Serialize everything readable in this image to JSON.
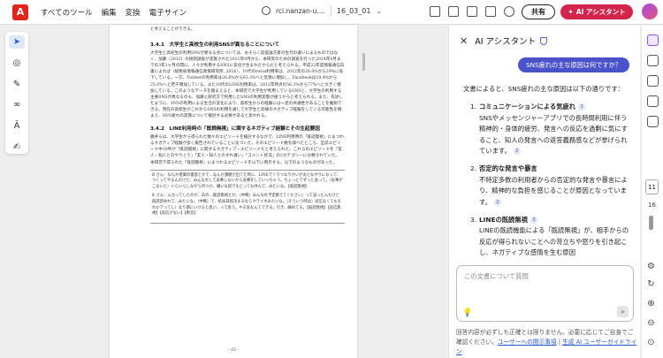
{
  "topbar": {
    "menu": [
      "すべてのツール",
      "編集",
      "変換",
      "電子サイン"
    ],
    "url": "rci.nanzan-u....",
    "filename": "16_03_01",
    "share_label": "共有",
    "ai_label": "AI アシスタント"
  },
  "document": {
    "top_line": "と考えることができる。",
    "section1_title": "3.4.1　大学生と高校生の利用SNSが異なることについて",
    "section1_body": "大学生と高校生の利用SNSが異なる点については、おそらく前提論方者の生代の違いによるものではなく、加藤（2013）の接続調査が実施された2011年9月から、本研究のための調査を行った2014年9月までの3年1ヶ月の間に、人々が利用するSNSに変化が生まれたからだと考えられる。平成22年度情報通信白書によれば（総務省情報通信政策研究所, 2016）、10代のtwiss利用率は、2012年の26.0%から29%に低下している。一方、Twitterの利用率は26.6%から63.3%へと急激に増加し、Facebookは19.4%から25.0%へと若干増加している。また10代のLINE利用率は、2012年時点の56.3%から77%へと大きく増加している。このようなデータを踏まえると、本研究で大学生が利用しているSNSと、大学生の利用する主要SNSが異なるのも、加藤と研究方で利用したSNSの利用実態が違うからと考えられる。また、先述したように、SNSの利用による生活の変化により、高校生からの経験には一定の共通性があることを推測できる。現在の高校生がこれからSNSの利用を通して大学生と同様のネガティブ経験をしている可能性を踏まえ、SNS疲れの実態について検討する必要があると思われる。",
    "section2_title": "3.4.2　LINE利用時の「既読無視」に関するネガティブ経験とその生起要因",
    "section2_body": "藤井らは、大学生から得られた数々のエピソードを検討するなかで、LINE利用時の「既読無視」にまつわるネガティブ経験が多く報告されていることに気づいた。そのエピソード数を調べたところ、全誌エピソード中30件が「既読無視」に関するネガティブ・エピソードだと考えられた。これらのエピソードを「友人・知人とのやりとり」「友人・知人とのすれ違い」「コメント状況」の3カテゴリーに分類されていた。",
    "section2_body2": "本研究で得られた「既読無視」にまつわるエピソードを以下に例示する。以下のようなものがあった。",
    "box1": "B さん：なんか授業の復習とかで…なんか課題が出てた時に、LINEでくりつなりかいがおとなやりになって、つくってやるんだけど、みんな大して返事しないから返事をしていっちゃう。ちょっとでずっと送って。（返事がこないと）いらいらしながら待つか、嫌いな奴でもどっても呼んで、みたいな。【既読無視】",
    "box2": "K さん：ムカってしたのが、あの…既読無視とか、（中略）みんなの予定教えてください」って送ったんだけど既読読めれて、みたいな。（中略）で、結局日程決まるならクライネみたいな。（そういう時は）返信なくてもそれかアってし）なり期にいけると思い、って思う。やる気なんてできる。引き、練めてる。【既読無視】【返信無視】【返信がない】【断念】",
    "page_number": "– 43 –"
  },
  "panel": {
    "title": "AI アシスタント",
    "user_question": "SNS疲れの主な原因は何ですか？",
    "intro": "文書によると、SNS疲れの主な原因は以下の通りです：",
    "items": [
      {
        "num": "1.",
        "head": "コミュニケーションによる気疲れ",
        "cite": "1",
        "body": "SNSやメッセンジャーアプリでの長時間利用に伴う精神的・身体的疲労、発言への反応を過剰に気にすること、知人の発言への返答義務感などが挙げられています。",
        "cite2": "2"
      },
      {
        "num": "2.",
        "head": "否定的な発言や暴言",
        "cite": "",
        "body": "不特定多数の利用者からの否定的な発言や暴言により、精神的な負担を感じることが原因となっています。",
        "cite2": "2"
      },
      {
        "num": "3.",
        "head": "LINEの既読無視",
        "cite": "3",
        "body": "LINEの既読機能による「既読無視」が、相手からの反応が得られないことへの苛立ちや怒りを引き起こし、ネガティブな感情を生む原因",
        "cite2": ""
      }
    ],
    "input_placeholder": "この文書について質問",
    "disclaimer_text": "回答内容が必ずしも正確とは限りません。必要に応じてご自身でご確認ください。",
    "link1": "ユーザーへの開示事項",
    "link_sep": " | ",
    "link2": "生成 AI ユーザーガイドライン"
  },
  "rail": {
    "current_page": "11",
    "total_pages": "16"
  }
}
